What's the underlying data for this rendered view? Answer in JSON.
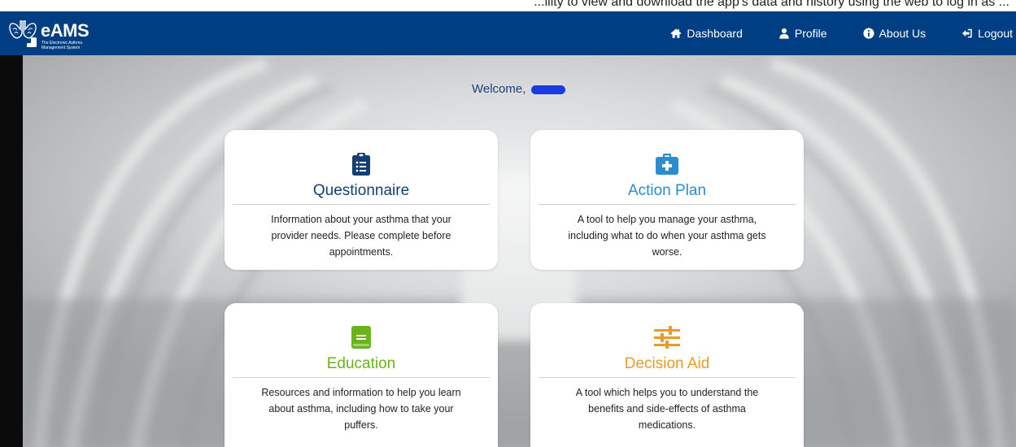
{
  "top_strip": {
    "text": "...ility to view and download the app's data and history using the web to log in as ..."
  },
  "brand": {
    "name": "eAMS",
    "tagline": "The Electronic Asthma Management System"
  },
  "nav": {
    "items": [
      {
        "label": "Dashboard",
        "icon": "home-icon"
      },
      {
        "label": "Profile",
        "icon": "user-icon"
      },
      {
        "label": "About Us",
        "icon": "info-icon"
      },
      {
        "label": "Logout",
        "icon": "sign-out-icon"
      }
    ]
  },
  "welcome": {
    "label": "Welcome,"
  },
  "cards": [
    {
      "title": "Questionnaire",
      "description": "Information about your asthma that your provider needs. Please complete before appointments.",
      "icon": "clipboard-list-icon",
      "color": "#123f73"
    },
    {
      "title": "Action Plan",
      "description": "A tool to help you manage your asthma, including what to do when your asthma gets worse.",
      "icon": "medical-kit-icon",
      "color": "#2b8dcf"
    },
    {
      "title": "Education",
      "description": "Resources and information to help you learn about asthma, including how to take your puffers.",
      "icon": "book-icon",
      "color": "#6ab31d"
    },
    {
      "title": "Decision Aid",
      "description": "A tool which helps you to understand the benefits and side-effects of asthma medications.",
      "icon": "sliders-icon",
      "color": "#e89a2b"
    }
  ],
  "colors": {
    "navbar": "#003e84",
    "welcome_text": "#1e3f7c"
  }
}
